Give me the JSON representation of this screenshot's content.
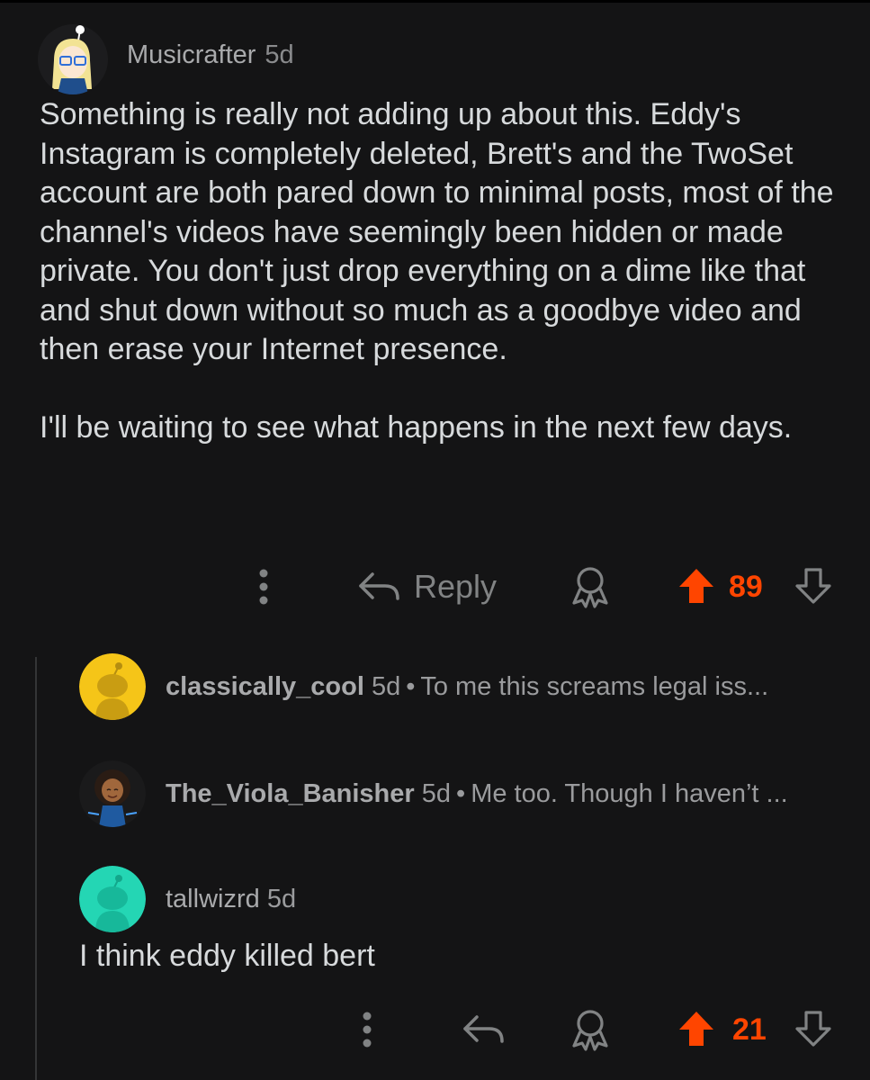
{
  "main_comment": {
    "author": "Musicrafter",
    "time": "5d",
    "paragraphs": [
      "Something is really not adding up about this. Eddy's Instagram is completely deleted, Brett's and the TwoSet account are both pared down to minimal posts, most of the channel's videos have seemingly been hidden or made private. You don't just drop everything on a dime like that and shut down without so much as a goodbye video and then erase your Internet presence.",
      "I'll be waiting to see what happens in the next few days."
    ],
    "actions": {
      "reply_label": "Reply",
      "score": "89"
    }
  },
  "replies": [
    {
      "author": "classically_cool",
      "time": "5d",
      "separator": "•",
      "preview": "To me this screams legal iss...",
      "avatar_color": "#f5c518"
    },
    {
      "author": "The_Viola_Banisher",
      "time": "5d",
      "separator": "•",
      "preview": "Me too. Though I haven’t ...",
      "avatar_color": "#1a1a1b"
    },
    {
      "author": "tallwizrd",
      "time": "5d",
      "body": "I think eddy killed bert",
      "avatar_color": "#24d6b4",
      "score": "21"
    }
  ],
  "colors": {
    "upvote": "#ff4500",
    "muted": "#818384",
    "background": "#141415"
  },
  "icons": [
    "more-icon",
    "reply-icon",
    "award-icon",
    "upvote-icon",
    "downvote-icon"
  ]
}
